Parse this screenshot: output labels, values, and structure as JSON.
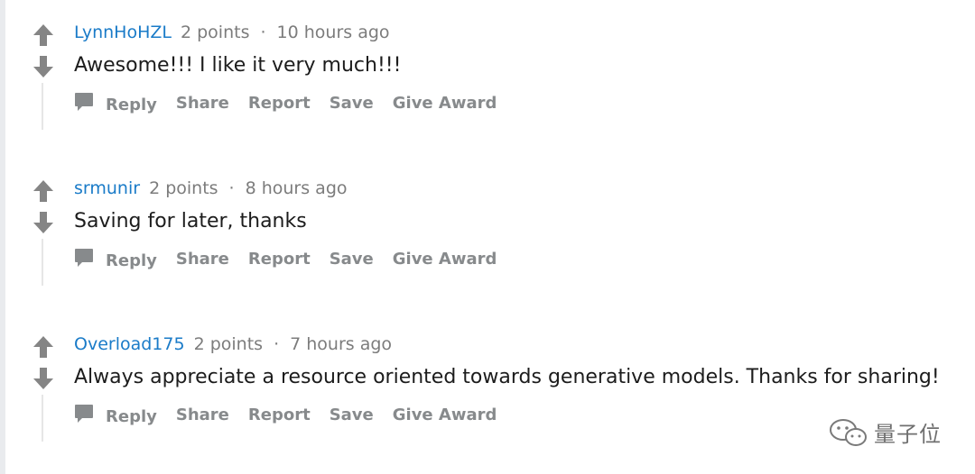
{
  "colors": {
    "author": "#1a7bc8",
    "meta": "#7c7c7c",
    "body": "#1c1c1c",
    "action": "#878a8c",
    "arrow": "#858585"
  },
  "icons": {
    "upvote": "arrow-up-icon",
    "downvote": "arrow-down-icon",
    "reply": "chat-bubble-icon",
    "watermark": "wechat-logo-icon"
  },
  "comments": [
    {
      "author": "LynnHoHZL",
      "points": "2 points",
      "separator": "·",
      "time": "10 hours ago",
      "text": "Awesome!!! I like it very much!!!",
      "actions": {
        "reply": "Reply",
        "share": "Share",
        "report": "Report",
        "save": "Save",
        "award": "Give Award"
      }
    },
    {
      "author": "srmunir",
      "points": "2 points",
      "separator": "·",
      "time": "8 hours ago",
      "text": "Saving for later, thanks",
      "actions": {
        "reply": "Reply",
        "share": "Share",
        "report": "Report",
        "save": "Save",
        "award": "Give Award"
      }
    },
    {
      "author": "Overload175",
      "points": "2 points",
      "separator": "·",
      "time": "7 hours ago",
      "text": "Always appreciate a resource oriented towards generative models. Thanks for sharing!",
      "actions": {
        "reply": "Reply",
        "share": "Share",
        "report": "Report",
        "save": "Save",
        "award": "Give Award"
      }
    }
  ],
  "watermark": {
    "text": "量子位"
  }
}
